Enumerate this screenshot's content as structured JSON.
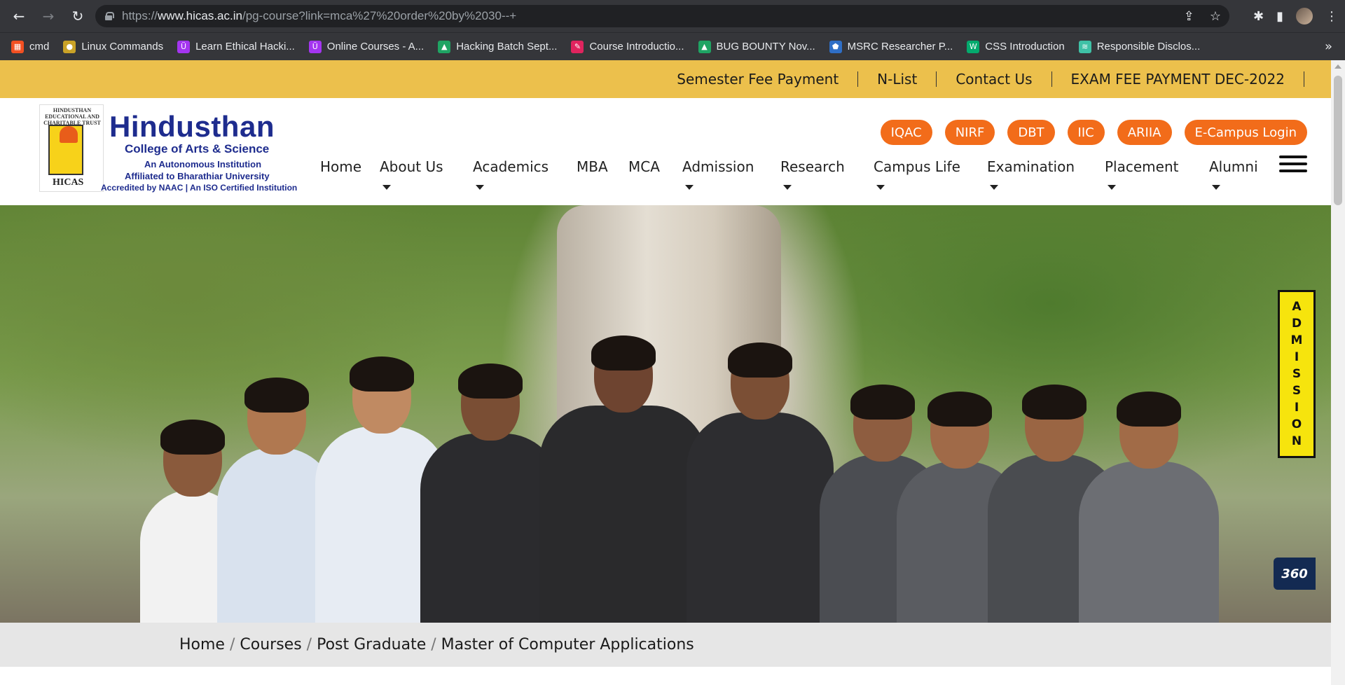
{
  "browser": {
    "url_prefix": "https://",
    "url_domain": "www.hicas.ac.in",
    "url_path": "/pg-course?link=mca%27%20order%20by%2030--+",
    "bookmarks": [
      {
        "label": "cmd",
        "icon": "windows-icon",
        "color": "#f25022"
      },
      {
        "label": "Linux Commands",
        "icon": "globe-icon",
        "color": "#c9a227"
      },
      {
        "label": "Learn Ethical Hacki...",
        "icon": "udemy-icon",
        "color": "#a435f0"
      },
      {
        "label": "Online Courses - A...",
        "icon": "udemy-icon",
        "color": "#a435f0"
      },
      {
        "label": "Hacking Batch Sept...",
        "icon": "drive-icon",
        "color": "#1fa463"
      },
      {
        "label": "Course Introductio...",
        "icon": "course-icon",
        "color": "#e0245e"
      },
      {
        "label": "BUG BOUNTY Nov...",
        "icon": "drive-icon",
        "color": "#1fa463"
      },
      {
        "label": "MSRC Researcher P...",
        "icon": "shield-icon",
        "color": "#2f6fc6"
      },
      {
        "label": "CSS Introduction",
        "icon": "w3-icon",
        "color": "#04aa6d"
      },
      {
        "label": "Responsible Disclos...",
        "icon": "wave-icon",
        "color": "#3fc1a6"
      }
    ]
  },
  "topbar": {
    "links": [
      "Semester Fee Payment",
      "N-List",
      "Contact Us",
      "EXAM FEE PAYMENT DEC-2022"
    ]
  },
  "logo": {
    "trust_text": "HINDUSTHAN EDUCATIONAL AND CHARITABLE TRUST",
    "short": "HICAS",
    "title": "Hindusthan",
    "subtitle": "College of Arts & Science",
    "line1": "An Autonomous Institution",
    "line2": "Affiliated to Bharathiar University",
    "line3": "Accredited by NAAC | An ISO Certified Institution"
  },
  "quick_links": [
    "IQAC",
    "NIRF",
    "DBT",
    "IIC",
    "ARIIA",
    "E-Campus Login"
  ],
  "nav": [
    {
      "label": "Home",
      "dropdown": false
    },
    {
      "label": "About Us",
      "dropdown": true
    },
    {
      "label": "Academics",
      "dropdown": true
    },
    {
      "label": "MBA",
      "dropdown": false
    },
    {
      "label": "MCA",
      "dropdown": false
    },
    {
      "label": "Admission",
      "dropdown": true
    },
    {
      "label": "Research",
      "dropdown": true
    },
    {
      "label": "Campus Life",
      "dropdown": true
    },
    {
      "label": "Examination",
      "dropdown": true
    },
    {
      "label": "Placement",
      "dropdown": true
    },
    {
      "label": "Alumni",
      "dropdown": true
    }
  ],
  "side": {
    "admission_letters": [
      "A",
      "D",
      "M",
      "I",
      "S",
      "S",
      "I",
      "O",
      "N"
    ],
    "tour_label": "360"
  },
  "breadcrumb": [
    "Home",
    "Courses",
    "Post Graduate",
    "Master of Computer Applications"
  ],
  "colors": {
    "topbar": "#ecc04c",
    "pill": "#f26c1a",
    "brand_blue": "#1e2c8e",
    "admission_tab": "#f6e40d"
  }
}
